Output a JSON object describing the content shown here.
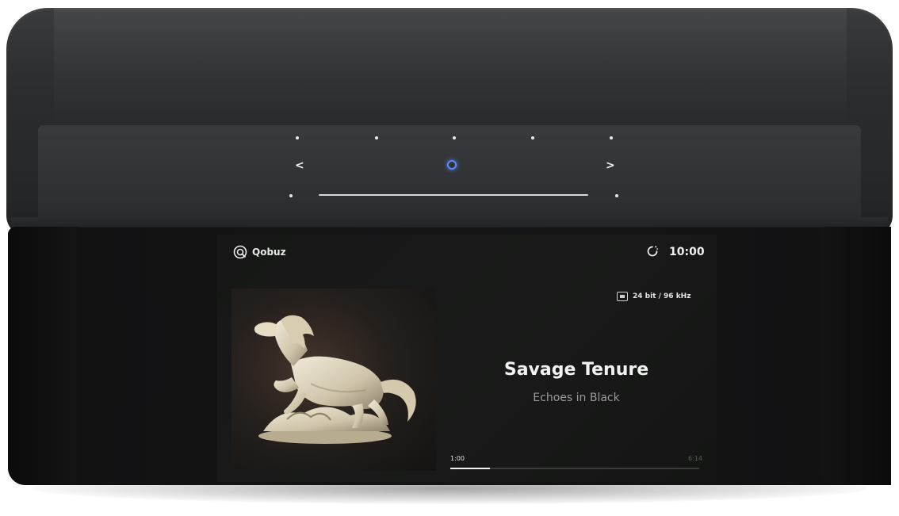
{
  "device": {
    "brand_accent": "#5b8cff",
    "touch_controls": {
      "prev_icon": "chevron-left-icon",
      "next_icon": "chevron-right-icon",
      "center_icon": "ring-icon"
    }
  },
  "screen": {
    "service": {
      "icon": "qobuz-logo-icon",
      "name": "Qobuz"
    },
    "timer_icon": "sleep-timer-icon",
    "clock": "10:00",
    "quality": {
      "icon": "hi-res-icon",
      "text": "24 bit / 96 kHz"
    },
    "album_art": {
      "icon": "album-cover-horse-sculpture"
    },
    "track": {
      "title": "Savage Tenure",
      "artist": "Echoes in Black"
    },
    "playback": {
      "elapsed": "1:00",
      "duration": "6:14",
      "progress": 0.16
    }
  }
}
